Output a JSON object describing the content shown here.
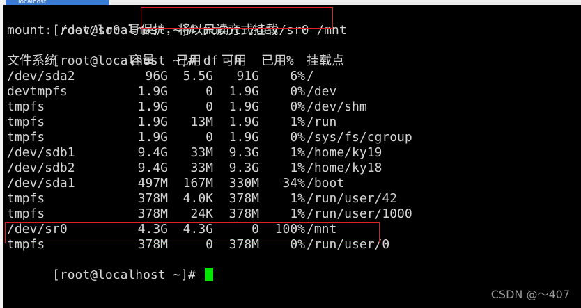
{
  "window": {
    "tab_title": "localhost"
  },
  "prompt": "[root@localhost ~]#",
  "commands": {
    "mount": "mount /dev/sr0 /mnt",
    "df": "df -h"
  },
  "mount_output": "mount: /dev/sr0 写保护，将以只读方式挂载",
  "df": {
    "headers": {
      "fs": "文件系统",
      "size": "容量",
      "used": "已用",
      "avail": "可用",
      "pct": "已用%",
      "mount": "挂载点"
    },
    "rows": [
      {
        "fs": "/dev/sda2",
        "size": "96G",
        "used": "5.5G",
        "avail": "91G",
        "pct": "6%",
        "mount": "/"
      },
      {
        "fs": "devtmpfs",
        "size": "1.9G",
        "used": "0",
        "avail": "1.9G",
        "pct": "0%",
        "mount": "/dev"
      },
      {
        "fs": "tmpfs",
        "size": "1.9G",
        "used": "0",
        "avail": "1.9G",
        "pct": "0%",
        "mount": "/dev/shm"
      },
      {
        "fs": "tmpfs",
        "size": "1.9G",
        "used": "13M",
        "avail": "1.9G",
        "pct": "1%",
        "mount": "/run"
      },
      {
        "fs": "tmpfs",
        "size": "1.9G",
        "used": "0",
        "avail": "1.9G",
        "pct": "0%",
        "mount": "/sys/fs/cgroup"
      },
      {
        "fs": "/dev/sdb1",
        "size": "9.4G",
        "used": "33M",
        "avail": "9.3G",
        "pct": "1%",
        "mount": "/home/ky19"
      },
      {
        "fs": "/dev/sdb2",
        "size": "9.4G",
        "used": "33M",
        "avail": "9.3G",
        "pct": "1%",
        "mount": "/home/ky18"
      },
      {
        "fs": "/dev/sda1",
        "size": "497M",
        "used": "167M",
        "avail": "330M",
        "pct": "34%",
        "mount": "/boot"
      },
      {
        "fs": "tmpfs",
        "size": "378M",
        "used": "4.0K",
        "avail": "378M",
        "pct": "1%",
        "mount": "/run/user/42"
      },
      {
        "fs": "tmpfs",
        "size": "378M",
        "used": "24K",
        "avail": "378M",
        "pct": "1%",
        "mount": "/run/user/1000"
      },
      {
        "fs": "/dev/sr0",
        "size": "4.3G",
        "used": "4.3G",
        "avail": "0",
        "pct": "100%",
        "mount": "/mnt"
      },
      {
        "fs": "tmpfs",
        "size": "378M",
        "used": "0",
        "avail": "378M",
        "pct": "0%",
        "mount": "/run/user/0"
      }
    ]
  },
  "watermark": "CSDN @～407",
  "colors": {
    "background": "#000000",
    "text": "#d4d4d4",
    "cursor": "#00e600",
    "highlight_box": "#e02020"
  }
}
